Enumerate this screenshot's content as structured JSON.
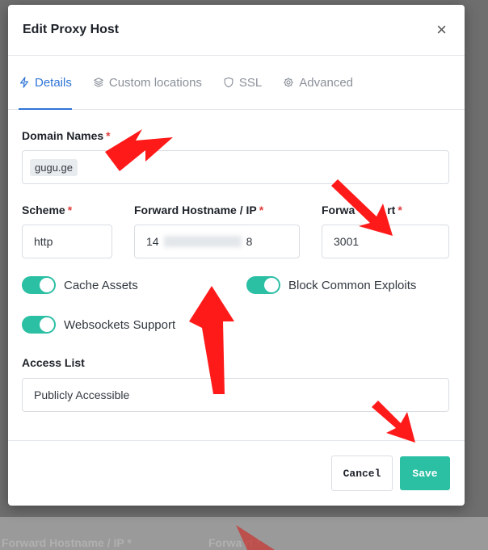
{
  "modal": {
    "title": "Edit Proxy Host",
    "close_glyph": "×"
  },
  "tabs": [
    {
      "label": "Details",
      "icon": "bolt-icon",
      "active": true
    },
    {
      "label": "Custom locations",
      "icon": "layers-icon",
      "active": false
    },
    {
      "label": "SSL",
      "icon": "shield-icon",
      "active": false
    },
    {
      "label": "Advanced",
      "icon": "gear-icon",
      "active": false
    }
  ],
  "form": {
    "domain_label": "Domain Names",
    "domain_chip": "gugu.ge",
    "scheme_label": "Scheme",
    "scheme_value": "http",
    "hostname_label": "Forward Hostname / IP",
    "hostname_prefix": "14",
    "hostname_suffix": "8",
    "port_label": "Forward Port",
    "port_label_visible": "Forwa",
    "port_label_tail": "rt",
    "port_value": "3001",
    "required_mark": "*",
    "cache_assets": "Cache Assets",
    "block_exploits": "Block Common Exploits",
    "websockets": "Websockets Support",
    "access_label": "Access List",
    "access_value": "Publicly Accessible"
  },
  "footer": {
    "cancel": "Cancel",
    "save": "Save"
  },
  "background": {
    "ghost_hostname": "Forward Hostname / IP *",
    "ghost_port": "Forwa   rt *"
  },
  "colors": {
    "accent": "#2f74d6",
    "teal": "#2bbfa4",
    "required": "#e03d3d",
    "annotation": "#ff1a1a"
  }
}
